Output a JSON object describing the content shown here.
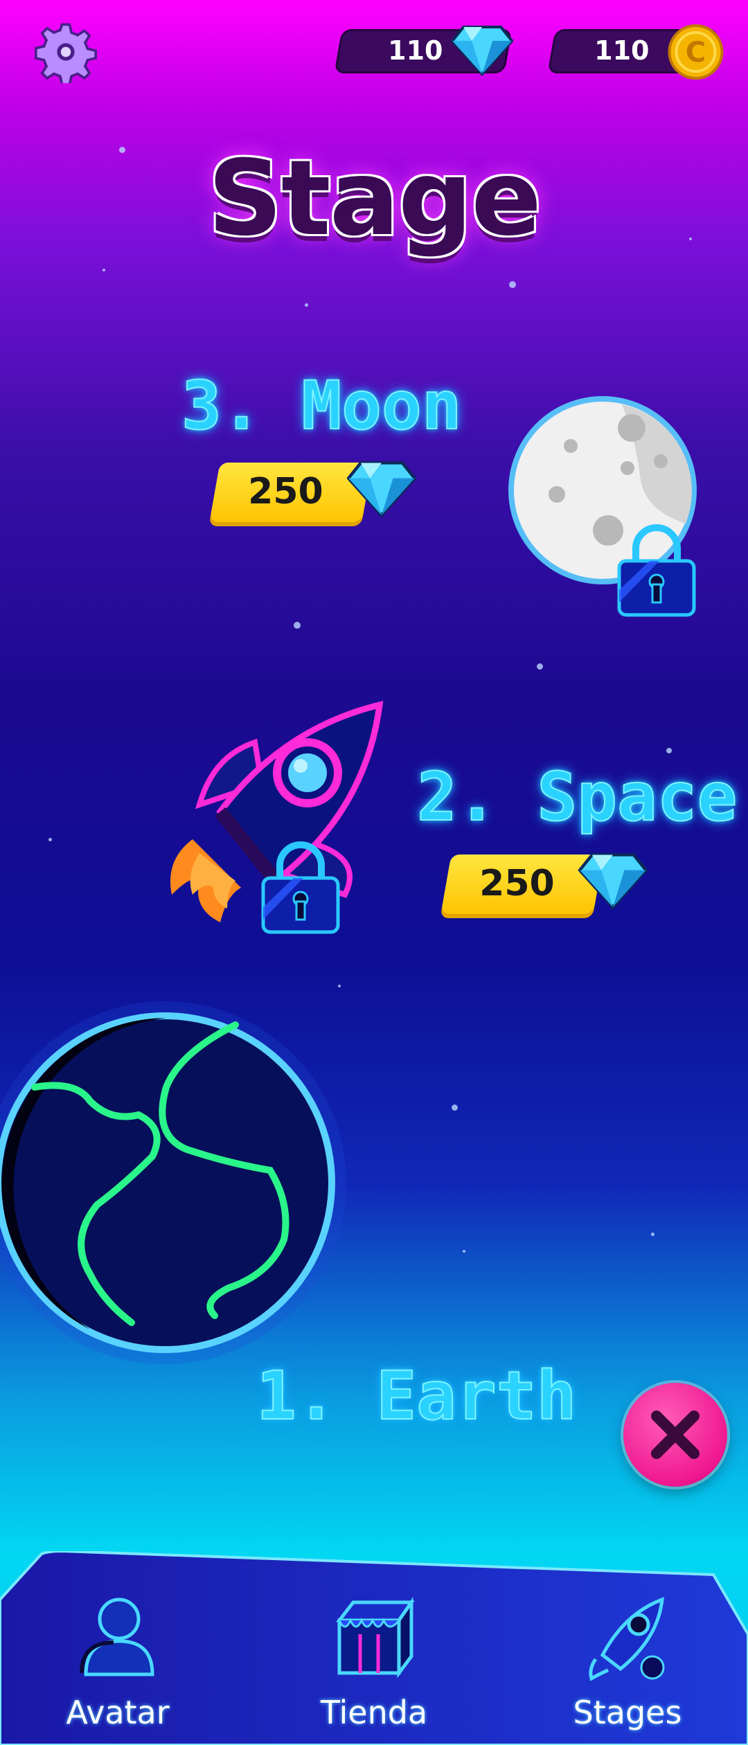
{
  "header": {
    "gems_count": "110",
    "coins_count": "110",
    "coin_letter": "C",
    "title": "Stage"
  },
  "stages": [
    {
      "name": "3. Moon",
      "price": "250",
      "locked": true,
      "planet": "moon"
    },
    {
      "name": "2. Space",
      "price": "250",
      "locked": true,
      "planet": "rocket"
    },
    {
      "name": "1. Earth",
      "locked": false,
      "planet": "earth"
    }
  ],
  "nav": {
    "items": [
      {
        "label": "Avatar",
        "icon": "user-icon"
      },
      {
        "label": "Tienda",
        "icon": "shop-icon"
      },
      {
        "label": "Stages",
        "icon": "rocket-icon"
      }
    ]
  },
  "colors": {
    "accent_cyan": "#2ad2ff",
    "gem": "#49d6ff",
    "coin": "#f5b400",
    "price_bg": "#ffd21f",
    "close": "#f01890",
    "earth_land": "#2af58a"
  }
}
